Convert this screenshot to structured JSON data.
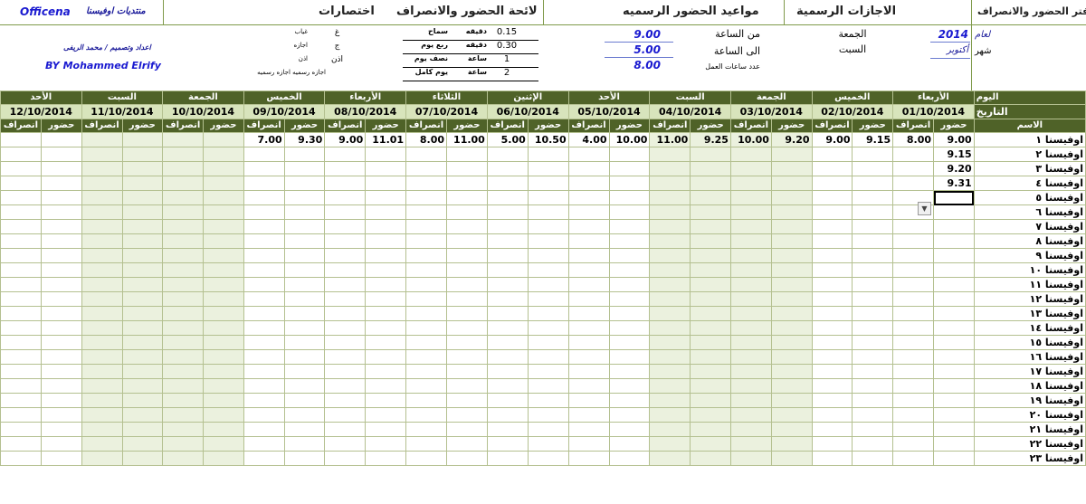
{
  "titles": {
    "register": "دفتر الحضور والانصراف",
    "holidays": "الاجازات الرسمية",
    "official_times": "مواعيد الحضور الرسميه",
    "regulations": "لائحة الحضور والانصراف",
    "abbrev": "اختصارات",
    "forum": "منتديات اوفيسنا",
    "brand": "Officena"
  },
  "settings": {
    "year_label": "لعام",
    "year": "2014",
    "month_label": "شهر",
    "month": "أكتوبر",
    "holiday1": "الجمعة",
    "holiday2": "السبت",
    "from_label": "من الساعة",
    "from": "9.00",
    "to_label": "الى الساعة",
    "to": "5.00",
    "work_label": "عدد ساعات العمل",
    "work": "8.00"
  },
  "rules": [
    {
      "label": "سماح",
      "unit": "دقيقه",
      "value": "0.15"
    },
    {
      "label": "ربع يوم",
      "unit": "دقيقه",
      "value": "0.30"
    },
    {
      "label": "نصف يوم",
      "unit": "ساعة",
      "value": "1"
    },
    {
      "label": "يوم كامل",
      "unit": "ساعة",
      "value": "2"
    }
  ],
  "abbreviations": [
    {
      "code": "غ",
      "meaning": "غياب"
    },
    {
      "code": "ج",
      "meaning": "اجازه"
    },
    {
      "code": "اذن",
      "meaning": "اذن"
    },
    {
      "code": "",
      "meaning": "اجازه رسميه اجازه رسميه"
    }
  ],
  "credits": {
    "design": "اعداد وتصميم / محمد الريفى",
    "by": "BY Mohammed Elrify"
  },
  "grid": {
    "row_label_day": "اليوم",
    "row_label_date": "التاريخ",
    "name_header": "الاسم",
    "in_label": "حضور",
    "out_label": "انصراف",
    "days": [
      {
        "day": "الأربعاء",
        "date": "01/10/2014",
        "in": "9.00",
        "out": "8.00",
        "alt": false
      },
      {
        "day": "الخميس",
        "date": "02/10/2014",
        "in": "9.15",
        "out": "9.00",
        "alt": false
      },
      {
        "day": "الجمعة",
        "date": "03/10/2014",
        "in": "9.20",
        "out": "10.00",
        "alt": true
      },
      {
        "day": "السبت",
        "date": "04/10/2014",
        "in": "9.25",
        "out": "11.00",
        "alt": true
      },
      {
        "day": "الأحد",
        "date": "05/10/2014",
        "in": "10.00",
        "out": "4.00",
        "alt": false
      },
      {
        "day": "الإثنين",
        "date": "06/10/2014",
        "in": "10.50",
        "out": "5.00",
        "alt": false
      },
      {
        "day": "الثلاثاء",
        "date": "07/10/2014",
        "in": "11.00",
        "out": "8.00",
        "alt": false
      },
      {
        "day": "الأربعاء",
        "date": "08/10/2014",
        "in": "11.01",
        "out": "9.00",
        "alt": false
      },
      {
        "day": "الخميس",
        "date": "09/10/2014",
        "in": "9.30",
        "out": "7.00",
        "alt": false
      },
      {
        "day": "الجمعة",
        "date": "10/10/2014",
        "in": "",
        "out": "",
        "alt": true
      },
      {
        "day": "السبت",
        "date": "11/10/2014",
        "in": "",
        "out": "",
        "alt": true
      },
      {
        "day": "الأحد",
        "date": "12/10/2014",
        "in": "",
        "out": "",
        "alt": false
      }
    ],
    "employees": [
      {
        "name": "اوفيسنا ١",
        "first_in": "9.00"
      },
      {
        "name": "اوفيسنا ٢",
        "first_in": "9.15"
      },
      {
        "name": "اوفيسنا ٣",
        "first_in": "9.20"
      },
      {
        "name": "اوفيسنا ٤",
        "first_in": "9.31"
      },
      {
        "name": "اوفيسنا ٥",
        "first_in": ""
      },
      {
        "name": "اوفيسنا ٦",
        "first_in": ""
      },
      {
        "name": "اوفيسنا ٧",
        "first_in": ""
      },
      {
        "name": "اوفيسنا ٨",
        "first_in": ""
      },
      {
        "name": "اوفيسنا ٩",
        "first_in": ""
      },
      {
        "name": "اوفيسنا ١٠",
        "first_in": ""
      },
      {
        "name": "اوفيسنا ١١",
        "first_in": ""
      },
      {
        "name": "اوفيسنا ١٢",
        "first_in": ""
      },
      {
        "name": "اوفيسنا ١٣",
        "first_in": ""
      },
      {
        "name": "اوفيسنا ١٤",
        "first_in": ""
      },
      {
        "name": "اوفيسنا ١٥",
        "first_in": ""
      },
      {
        "name": "اوفيسنا ١٦",
        "first_in": ""
      },
      {
        "name": "اوفيسنا ١٧",
        "first_in": ""
      },
      {
        "name": "اوفيسنا ١٨",
        "first_in": ""
      },
      {
        "name": "اوفيسنا ١٩",
        "first_in": ""
      },
      {
        "name": "اوفيسنا ٢٠",
        "first_in": ""
      },
      {
        "name": "اوفيسنا ٢١",
        "first_in": ""
      },
      {
        "name": "اوفيسنا ٢٢",
        "first_in": ""
      },
      {
        "name": "اوفيسنا ٢٣",
        "first_in": ""
      }
    ]
  },
  "colors": {
    "header_green": "#4f6228",
    "date_green": "#d8e4bc",
    "weekend": "#ebf1de"
  }
}
